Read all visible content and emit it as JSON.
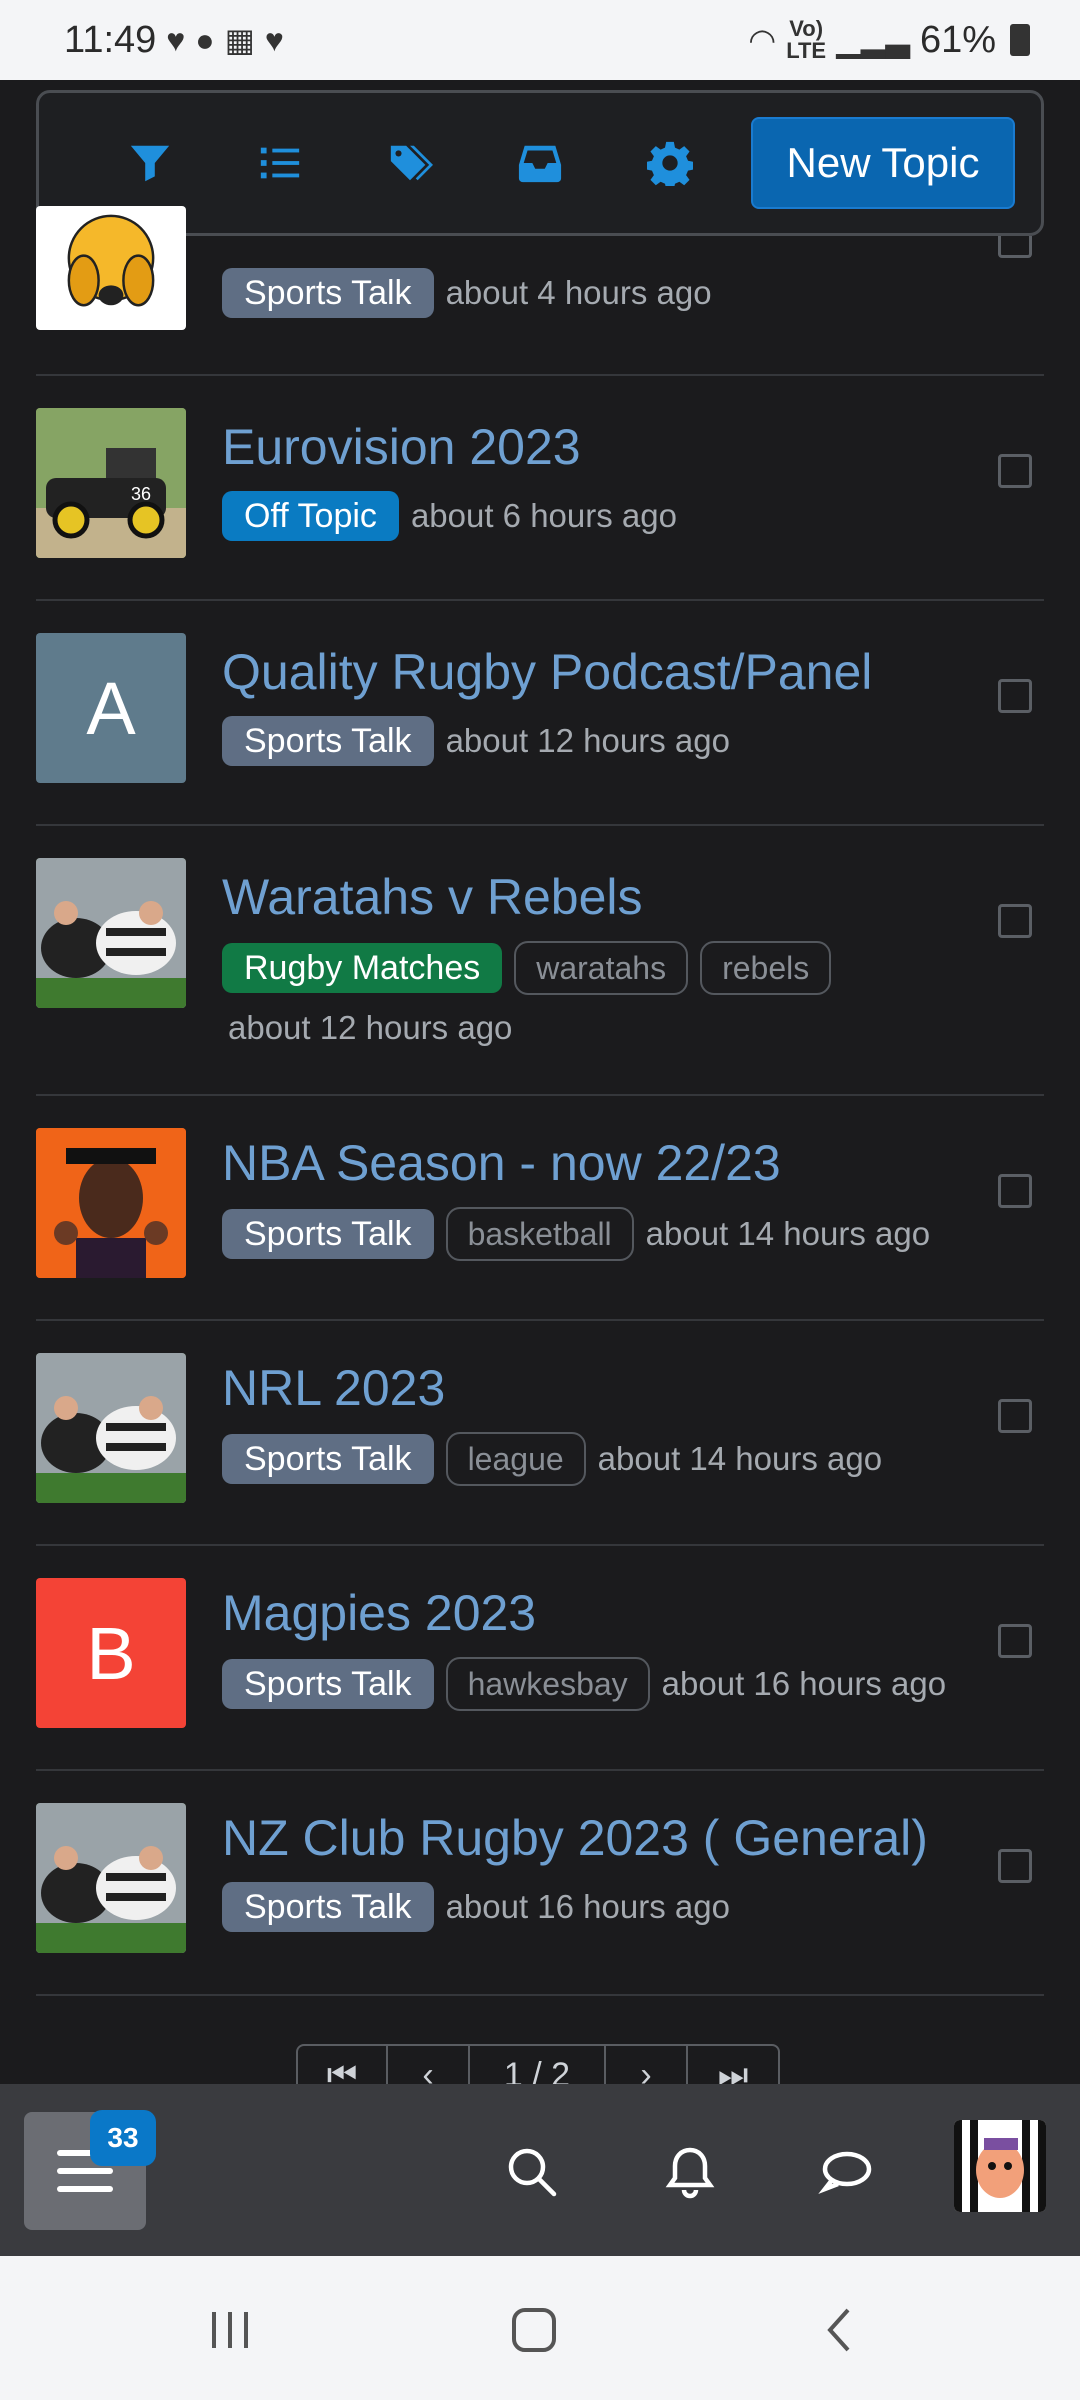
{
  "status_bar": {
    "time": "11:49",
    "volte_top": "Vo)",
    "volte_bottom": "LTE",
    "battery": "61%"
  },
  "toolbar": {
    "icons": [
      "filter-icon",
      "list-icon",
      "tags-icon",
      "inbox-icon",
      "gear-icon"
    ],
    "new_topic_label": "New Topic"
  },
  "topics": [
    {
      "title": "",
      "category": "Sports Talk",
      "category_color": "#5f6e84",
      "tags": [],
      "time": "about 4 hours ago",
      "avatar_letter": ""
    },
    {
      "title": "Eurovision 2023",
      "category": "Off Topic",
      "category_color": "#0a7bc2",
      "tags": [],
      "time": "about 6 hours ago",
      "avatar_letter": ""
    },
    {
      "title": "Quality Rugby Podcast/Panel",
      "category": "Sports Talk",
      "category_color": "#5f6e84",
      "tags": [],
      "time": "about 12 hours ago",
      "avatar_letter": "A",
      "avatar_color": "#5f7b8c"
    },
    {
      "title": "Waratahs v Rebels",
      "category": "Rugby Matches",
      "category_color": "#117a45",
      "tags": [
        "waratahs",
        "rebels"
      ],
      "time": "about 12 hours ago",
      "avatar_letter": ""
    },
    {
      "title": "NBA Season - now 22/23",
      "category": "Sports Talk",
      "category_color": "#5f6e84",
      "tags": [
        "basketball"
      ],
      "time": "about 14 hours ago",
      "avatar_letter": ""
    },
    {
      "title": "NRL 2023",
      "category": "Sports Talk",
      "category_color": "#5f6e84",
      "tags": [
        "league"
      ],
      "time": "about 14 hours ago",
      "avatar_letter": ""
    },
    {
      "title": "Magpies 2023",
      "category": "Sports Talk",
      "category_color": "#5f6e84",
      "tags": [
        "hawkesbay"
      ],
      "time": "about 16 hours ago",
      "avatar_letter": "B",
      "avatar_color": "#f44336"
    },
    {
      "title": "NZ Club Rugby 2023 ( General)",
      "category": "Sports Talk",
      "category_color": "#5f6e84",
      "tags": [],
      "time": "about 16 hours ago",
      "avatar_letter": ""
    }
  ],
  "pagination": {
    "first": "⏮",
    "prev": "‹",
    "current": "1 / 2",
    "next": "›",
    "last": "⏭"
  },
  "bottom_bar": {
    "menu_badge": "33",
    "icons": [
      "search-icon",
      "bell-icon",
      "chat-icon"
    ]
  }
}
